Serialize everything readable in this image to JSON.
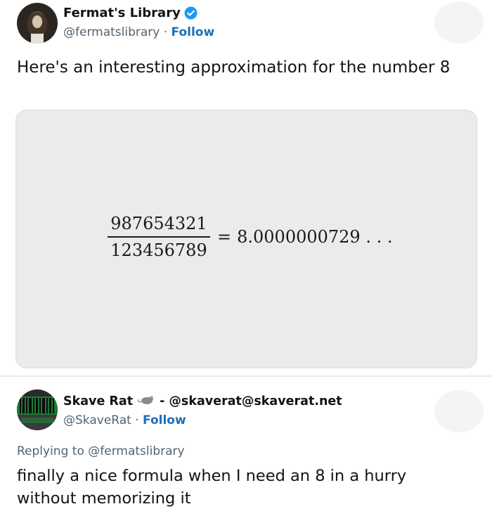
{
  "tweet_main": {
    "author_name": "Fermat's Library",
    "handle": "@fermatslibrary",
    "separator": " · ",
    "follow_label": "Follow",
    "text": "Here's an interesting approximation for the number 8",
    "verified_icon": "verified-badge-icon",
    "formula": {
      "numerator": "987654321",
      "denominator": "123456789",
      "equals": "=",
      "result": "8.0000000729 . . ."
    }
  },
  "tweet_reply": {
    "author_name": "Skave Rat",
    "name_suffix": "- @skaverat@skaverat.net",
    "handle": "@SkaveRat",
    "separator": " · ",
    "follow_label": "Follow",
    "replying_to": "Replying to @fermatslibrary",
    "text": "finally a nice formula when I need an 8 in a hurry without memorizing it",
    "rat_icon": "rat-icon"
  },
  "colors": {
    "link": "#1d6fb8",
    "secondary_text": "#536471",
    "verified": "#1d9bf0",
    "media_background": "#ebebeb"
  }
}
